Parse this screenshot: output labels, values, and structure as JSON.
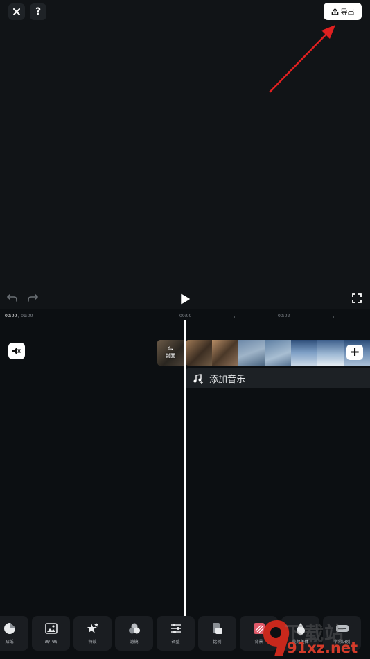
{
  "top_bar": {
    "close_icon": "close-icon",
    "help_label": "?",
    "export_label": "导出",
    "accent": "#e02020"
  },
  "timeline": {
    "current_time": "00:00",
    "total_time": " / 01:00",
    "marker_1": "00:00",
    "marker_2": "00:02",
    "cover_label": "封面",
    "add_music_label": "添加音乐"
  },
  "toolbar": {
    "items": [
      {
        "label": "贴纸",
        "icon": "sticker-icon"
      },
      {
        "label": "画中画",
        "icon": "picture-in-picture-icon"
      },
      {
        "label": "特效",
        "icon": "effects-icon"
      },
      {
        "label": "滤镜",
        "icon": "filter-icon"
      },
      {
        "label": "调整",
        "icon": "adjust-icon"
      },
      {
        "label": "比例",
        "icon": "ratio-icon"
      },
      {
        "label": "背景",
        "icon": "background-icon"
      },
      {
        "label": "美颜美体",
        "icon": "beauty-icon"
      },
      {
        "label": "字幕识别",
        "icon": "caption-icon"
      }
    ]
  },
  "watermark": {
    "text": "下载站",
    "url": "91xz.net"
  }
}
